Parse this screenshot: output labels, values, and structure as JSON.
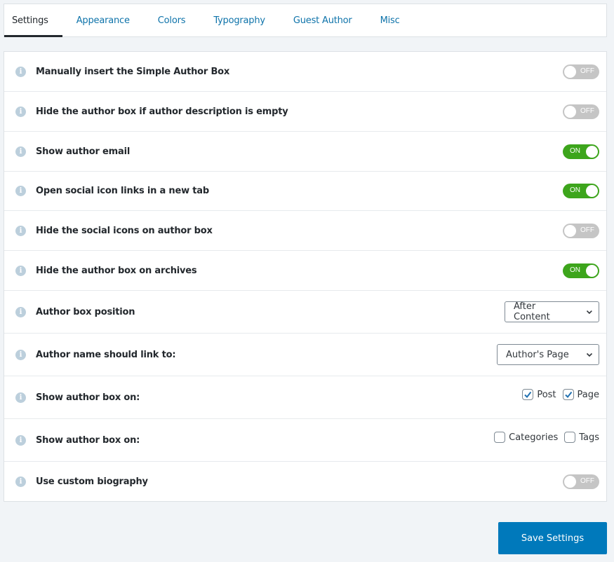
{
  "tabs": [
    {
      "label": "Settings",
      "active": true
    },
    {
      "label": "Appearance",
      "active": false
    },
    {
      "label": "Colors",
      "active": false
    },
    {
      "label": "Typography",
      "active": false
    },
    {
      "label": "Guest Author",
      "active": false
    },
    {
      "label": "Misc",
      "active": false
    }
  ],
  "settings": [
    {
      "label": "Manually insert the Simple Author Box",
      "control": "toggle",
      "state": "OFF"
    },
    {
      "label": "Hide the author box if author description is empty",
      "control": "toggle",
      "state": "OFF"
    },
    {
      "label": "Show author email",
      "control": "toggle",
      "state": "ON"
    },
    {
      "label": "Open social icon links in a new tab",
      "control": "toggle",
      "state": "ON"
    },
    {
      "label": "Hide the social icons on author box",
      "control": "toggle",
      "state": "OFF"
    },
    {
      "label": "Hide the author box on archives",
      "control": "toggle",
      "state": "ON"
    },
    {
      "label": "Author box position",
      "control": "select",
      "value": "After Content"
    },
    {
      "label": "Author name should link to:",
      "control": "select",
      "value": "Author's Page"
    },
    {
      "label": "Show author box on:",
      "control": "checkboxes",
      "options": [
        {
          "label": "Post",
          "checked": true
        },
        {
          "label": "Page",
          "checked": true
        }
      ]
    },
    {
      "label": "Show author box on:",
      "control": "checkboxes",
      "options": [
        {
          "label": "Categories",
          "checked": false
        },
        {
          "label": "Tags",
          "checked": false
        }
      ]
    },
    {
      "label": "Use custom biography",
      "control": "toggle",
      "state": "OFF"
    }
  ],
  "save_button": "Save Settings",
  "colors": {
    "accent": "#0079bb",
    "toggle_on": "#3da51c",
    "toggle_off": "#c5c5c5",
    "link": "#0e73aa"
  }
}
